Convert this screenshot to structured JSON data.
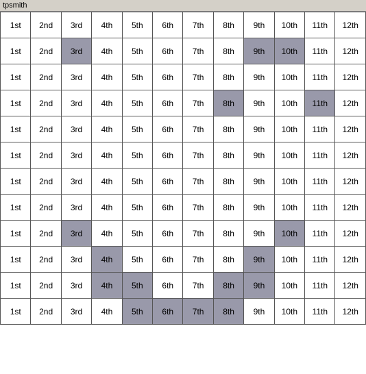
{
  "title": "tpsmith",
  "rows": [
    {
      "cells": [
        {
          "text": "1st",
          "style": ""
        },
        {
          "text": "2nd",
          "style": ""
        },
        {
          "text": "3rd",
          "style": ""
        },
        {
          "text": "4th",
          "style": ""
        },
        {
          "text": "5th",
          "style": ""
        },
        {
          "text": "6th",
          "style": ""
        },
        {
          "text": "7th",
          "style": ""
        },
        {
          "text": "8th",
          "style": ""
        },
        {
          "text": "9th",
          "style": ""
        },
        {
          "text": "10th",
          "style": ""
        },
        {
          "text": "11th",
          "style": ""
        },
        {
          "text": "12th",
          "style": ""
        }
      ]
    },
    {
      "cells": [
        {
          "text": "1st",
          "style": ""
        },
        {
          "text": "2nd",
          "style": ""
        },
        {
          "text": "3rd",
          "style": "highlighted-dark"
        },
        {
          "text": "4th",
          "style": ""
        },
        {
          "text": "5th",
          "style": ""
        },
        {
          "text": "6th",
          "style": ""
        },
        {
          "text": "7th",
          "style": ""
        },
        {
          "text": "8th",
          "style": ""
        },
        {
          "text": "9th",
          "style": "highlighted-dark"
        },
        {
          "text": "10th",
          "style": "highlighted-dark"
        },
        {
          "text": "11th",
          "style": ""
        },
        {
          "text": "12th",
          "style": ""
        }
      ]
    },
    {
      "cells": [
        {
          "text": "1st",
          "style": ""
        },
        {
          "text": "2nd",
          "style": ""
        },
        {
          "text": "3rd",
          "style": ""
        },
        {
          "text": "4th",
          "style": ""
        },
        {
          "text": "5th",
          "style": ""
        },
        {
          "text": "6th",
          "style": ""
        },
        {
          "text": "7th",
          "style": ""
        },
        {
          "text": "8th",
          "style": ""
        },
        {
          "text": "9th",
          "style": ""
        },
        {
          "text": "10th",
          "style": ""
        },
        {
          "text": "11th",
          "style": ""
        },
        {
          "text": "12th",
          "style": ""
        }
      ]
    },
    {
      "cells": [
        {
          "text": "1st",
          "style": ""
        },
        {
          "text": "2nd",
          "style": ""
        },
        {
          "text": "3rd",
          "style": ""
        },
        {
          "text": "4th",
          "style": ""
        },
        {
          "text": "5th",
          "style": ""
        },
        {
          "text": "6th",
          "style": ""
        },
        {
          "text": "7th",
          "style": ""
        },
        {
          "text": "8th",
          "style": "highlighted-dark"
        },
        {
          "text": "9th",
          "style": ""
        },
        {
          "text": "10th",
          "style": ""
        },
        {
          "text": "11th",
          "style": "highlighted-dark"
        },
        {
          "text": "12th",
          "style": ""
        }
      ]
    },
    {
      "cells": [
        {
          "text": "1st",
          "style": ""
        },
        {
          "text": "2nd",
          "style": ""
        },
        {
          "text": "3rd",
          "style": ""
        },
        {
          "text": "4th",
          "style": ""
        },
        {
          "text": "5th",
          "style": ""
        },
        {
          "text": "6th",
          "style": ""
        },
        {
          "text": "7th",
          "style": ""
        },
        {
          "text": "8th",
          "style": ""
        },
        {
          "text": "9th",
          "style": ""
        },
        {
          "text": "10th",
          "style": ""
        },
        {
          "text": "11th",
          "style": ""
        },
        {
          "text": "12th",
          "style": ""
        }
      ]
    },
    {
      "cells": [
        {
          "text": "1st",
          "style": ""
        },
        {
          "text": "2nd",
          "style": ""
        },
        {
          "text": "3rd",
          "style": ""
        },
        {
          "text": "4th",
          "style": ""
        },
        {
          "text": "5th",
          "style": ""
        },
        {
          "text": "6th",
          "style": ""
        },
        {
          "text": "7th",
          "style": ""
        },
        {
          "text": "8th",
          "style": ""
        },
        {
          "text": "9th",
          "style": ""
        },
        {
          "text": "10th",
          "style": ""
        },
        {
          "text": "11th",
          "style": ""
        },
        {
          "text": "12th",
          "style": ""
        }
      ]
    },
    {
      "cells": [
        {
          "text": "1st",
          "style": ""
        },
        {
          "text": "2nd",
          "style": ""
        },
        {
          "text": "3rd",
          "style": ""
        },
        {
          "text": "4th",
          "style": ""
        },
        {
          "text": "5th",
          "style": ""
        },
        {
          "text": "6th",
          "style": ""
        },
        {
          "text": "7th",
          "style": ""
        },
        {
          "text": "8th",
          "style": ""
        },
        {
          "text": "9th",
          "style": ""
        },
        {
          "text": "10th",
          "style": ""
        },
        {
          "text": "11th",
          "style": ""
        },
        {
          "text": "12th",
          "style": ""
        }
      ]
    },
    {
      "cells": [
        {
          "text": "1st",
          "style": ""
        },
        {
          "text": "2nd",
          "style": ""
        },
        {
          "text": "3rd",
          "style": ""
        },
        {
          "text": "4th",
          "style": ""
        },
        {
          "text": "5th",
          "style": ""
        },
        {
          "text": "6th",
          "style": ""
        },
        {
          "text": "7th",
          "style": ""
        },
        {
          "text": "8th",
          "style": ""
        },
        {
          "text": "9th",
          "style": ""
        },
        {
          "text": "10th",
          "style": ""
        },
        {
          "text": "11th",
          "style": ""
        },
        {
          "text": "12th",
          "style": ""
        }
      ]
    },
    {
      "cells": [
        {
          "text": "1st",
          "style": ""
        },
        {
          "text": "2nd",
          "style": ""
        },
        {
          "text": "3rd",
          "style": "highlighted-dark"
        },
        {
          "text": "4th",
          "style": ""
        },
        {
          "text": "5th",
          "style": ""
        },
        {
          "text": "6th",
          "style": ""
        },
        {
          "text": "7th",
          "style": ""
        },
        {
          "text": "8th",
          "style": ""
        },
        {
          "text": "9th",
          "style": ""
        },
        {
          "text": "10th",
          "style": "highlighted-dark"
        },
        {
          "text": "11th",
          "style": ""
        },
        {
          "text": "12th",
          "style": ""
        }
      ]
    },
    {
      "cells": [
        {
          "text": "1st",
          "style": ""
        },
        {
          "text": "2nd",
          "style": ""
        },
        {
          "text": "3rd",
          "style": ""
        },
        {
          "text": "4th",
          "style": "highlighted-dark"
        },
        {
          "text": "5th",
          "style": ""
        },
        {
          "text": "6th",
          "style": ""
        },
        {
          "text": "7th",
          "style": ""
        },
        {
          "text": "8th",
          "style": ""
        },
        {
          "text": "9th",
          "style": "highlighted-dark"
        },
        {
          "text": "10th",
          "style": ""
        },
        {
          "text": "11th",
          "style": ""
        },
        {
          "text": "12th",
          "style": ""
        }
      ]
    },
    {
      "cells": [
        {
          "text": "1st",
          "style": ""
        },
        {
          "text": "2nd",
          "style": ""
        },
        {
          "text": "3rd",
          "style": ""
        },
        {
          "text": "4th",
          "style": "highlighted-dark"
        },
        {
          "text": "5th",
          "style": "highlighted-dark"
        },
        {
          "text": "6th",
          "style": ""
        },
        {
          "text": "7th",
          "style": ""
        },
        {
          "text": "8th",
          "style": "highlighted-dark"
        },
        {
          "text": "9th",
          "style": "highlighted-dark"
        },
        {
          "text": "10th",
          "style": ""
        },
        {
          "text": "11th",
          "style": ""
        },
        {
          "text": "12th",
          "style": ""
        }
      ]
    },
    {
      "cells": [
        {
          "text": "1st",
          "style": ""
        },
        {
          "text": "2nd",
          "style": ""
        },
        {
          "text": "3rd",
          "style": ""
        },
        {
          "text": "4th",
          "style": ""
        },
        {
          "text": "5th",
          "style": "highlighted-dark"
        },
        {
          "text": "6th",
          "style": "highlighted-dark"
        },
        {
          "text": "7th",
          "style": "highlighted-dark"
        },
        {
          "text": "8th",
          "style": "highlighted-dark"
        },
        {
          "text": "9th",
          "style": ""
        },
        {
          "text": "10th",
          "style": ""
        },
        {
          "text": "11th",
          "style": ""
        },
        {
          "text": "12th",
          "style": ""
        }
      ]
    }
  ]
}
